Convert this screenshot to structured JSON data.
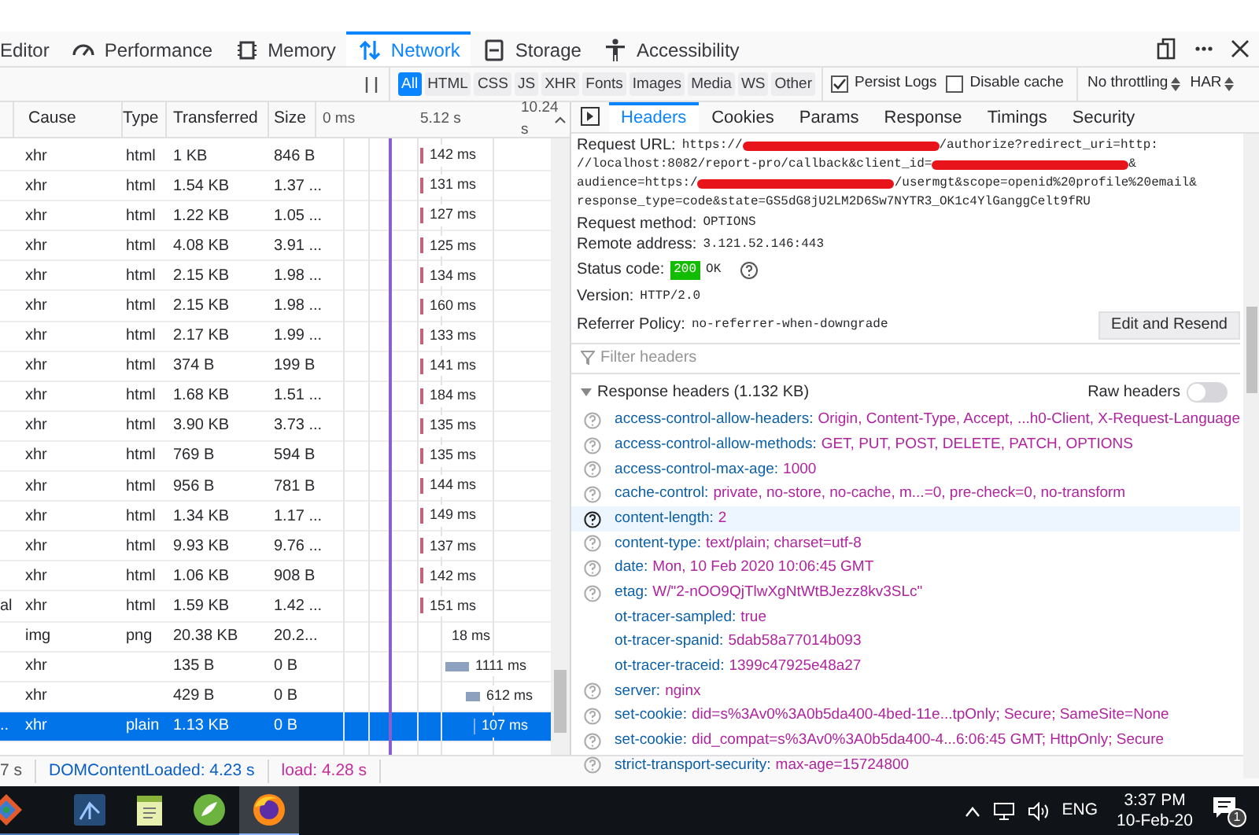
{
  "toolbox_tabs": [
    {
      "label": "Editor",
      "selected": false
    },
    {
      "label": "Performance",
      "selected": false
    },
    {
      "label": "Memory",
      "selected": false
    },
    {
      "label": "Network",
      "selected": true
    },
    {
      "label": "Storage",
      "selected": false
    },
    {
      "label": "Accessibility",
      "selected": false
    }
  ],
  "filters": [
    {
      "label": "All",
      "selected": true
    },
    {
      "label": "HTML",
      "selected": false
    },
    {
      "label": "CSS",
      "selected": false
    },
    {
      "label": "JS",
      "selected": false
    },
    {
      "label": "XHR",
      "selected": false
    },
    {
      "label": "Fonts",
      "selected": false
    },
    {
      "label": "Images",
      "selected": false
    },
    {
      "label": "Media",
      "selected": false
    },
    {
      "label": "WS",
      "selected": false
    },
    {
      "label": "Other",
      "selected": false
    }
  ],
  "options": [
    {
      "label": "Persist Logs",
      "checked": true
    },
    {
      "label": "Disable cache",
      "checked": false
    }
  ],
  "selects": [
    "No throttling",
    "HAR"
  ],
  "columns": [
    "Cause",
    "Type",
    "Transferred",
    "Size"
  ],
  "timeline_ticks": [
    "0 ms",
    "5.12 s",
    "10.24 s"
  ],
  "requests": [
    {
      "cause": "xhr",
      "type": "html",
      "transferred": "1 KB",
      "size": "846 B",
      "time": "142 ms",
      "kind": "tick",
      "selected": false
    },
    {
      "cause": "xhr",
      "type": "html",
      "transferred": "1.54 KB",
      "size": "1.37 ...",
      "time": "131 ms",
      "kind": "tick",
      "selected": false
    },
    {
      "cause": "xhr",
      "type": "html",
      "transferred": "1.22 KB",
      "size": "1.05 ...",
      "time": "127 ms",
      "kind": "tick",
      "selected": false
    },
    {
      "cause": "xhr",
      "type": "html",
      "transferred": "4.08 KB",
      "size": "3.91 ...",
      "time": "125 ms",
      "kind": "tick",
      "selected": false
    },
    {
      "cause": "xhr",
      "type": "html",
      "transferred": "2.15 KB",
      "size": "1.98 ...",
      "time": "134 ms",
      "kind": "tick",
      "selected": false
    },
    {
      "cause": "xhr",
      "type": "html",
      "transferred": "2.15 KB",
      "size": "1.98 ...",
      "time": "160 ms",
      "kind": "tick",
      "selected": false
    },
    {
      "cause": "xhr",
      "type": "html",
      "transferred": "2.17 KB",
      "size": "1.99 ...",
      "time": "133 ms",
      "kind": "tick",
      "selected": false
    },
    {
      "cause": "xhr",
      "type": "html",
      "transferred": "374 B",
      "size": "199 B",
      "time": "141 ms",
      "kind": "tick",
      "selected": false
    },
    {
      "cause": "xhr",
      "type": "html",
      "transferred": "1.68 KB",
      "size": "1.51 ...",
      "time": "184 ms",
      "kind": "tick",
      "selected": false
    },
    {
      "cause": "xhr",
      "type": "html",
      "transferred": "3.90 KB",
      "size": "3.73 ...",
      "time": "135 ms",
      "kind": "tick",
      "selected": false
    },
    {
      "cause": "xhr",
      "type": "html",
      "transferred": "769 B",
      "size": "594 B",
      "time": "135 ms",
      "kind": "tick",
      "selected": false
    },
    {
      "cause": "xhr",
      "type": "html",
      "transferred": "956 B",
      "size": "781 B",
      "time": "144 ms",
      "kind": "tick",
      "selected": false
    },
    {
      "cause": "xhr",
      "type": "html",
      "transferred": "1.34 KB",
      "size": "1.17 ...",
      "time": "149 ms",
      "kind": "tick",
      "selected": false
    },
    {
      "cause": "xhr",
      "type": "html",
      "transferred": "9.93 KB",
      "size": "9.76 ...",
      "time": "137 ms",
      "kind": "tick",
      "selected": false
    },
    {
      "cause": "xhr",
      "type": "html",
      "transferred": "1.06 KB",
      "size": "908 B",
      "time": "142 ms",
      "kind": "tick",
      "selected": false
    },
    {
      "column_1": "al",
      "cause": "xhr",
      "type": "html",
      "transferred": "1.59 KB",
      "size": "1.42 ...",
      "time": "151 ms",
      "kind": "tick",
      "selected": false
    },
    {
      "cause": "img",
      "type": "png",
      "transferred": "20.38 KB",
      "size": "20.2...",
      "time": "18 ms",
      "kind": "late",
      "selected": false
    },
    {
      "cause": "xhr",
      "transferred": "135 B",
      "size": "0 B",
      "time": "1111 ms",
      "kind": "wide",
      "selected": false
    },
    {
      "cause": "xhr",
      "transferred": "429 B",
      "size": "0 B",
      "time": "612 ms",
      "kind": "medium",
      "selected": false
    },
    {
      "column_1": "..",
      "cause": "xhr",
      "type": "plain",
      "transferred": "1.13 KB",
      "size": "0 B",
      "time": "107 ms",
      "kind": "thin",
      "selected": true
    }
  ],
  "status_bar": [
    "7 s",
    "DOMContentLoaded: 4.23 s",
    "load: 4.28 s"
  ],
  "detail_tabs": [
    {
      "label": "Headers",
      "selected": true
    },
    {
      "label": "Cookies",
      "selected": false
    },
    {
      "label": "Params",
      "selected": false
    },
    {
      "label": "Response",
      "selected": false
    },
    {
      "label": "Timings",
      "selected": false
    },
    {
      "label": "Security",
      "selected": false
    }
  ],
  "request_url": {
    "label": "Request URL:",
    "lines": [
      [
        {
          "kind": "text",
          "text": "https://"
        },
        {
          "kind": "redacted"
        },
        {
          "kind": "text",
          "text": "/authorize?redirect_uri=http:"
        }
      ],
      [
        {
          "kind": "text",
          "text": "//localhost:8082/report-pro/callback&client_id="
        },
        {
          "kind": "redacted"
        },
        {
          "kind": "text",
          "text": "&"
        }
      ],
      [
        {
          "kind": "text",
          "text": "audience=https:/"
        },
        {
          "kind": "redacted"
        },
        {
          "kind": "text",
          "text": "/usermgt&scope=openid%20profile%20email&"
        }
      ],
      [
        {
          "kind": "text",
          "text": "response_type=code&state=GS5dG8jU2LM2D6Sw7NYTR3_OK1c4YlGanggCelt9fRU"
        }
      ]
    ]
  },
  "request_method": {
    "label": "Request method:",
    "value": "OPTIONS"
  },
  "remote_address": {
    "label": "Remote address:",
    "value": "3.121.52.146:443"
  },
  "status_code": {
    "label": "Status code:",
    "code": "200",
    "text": "OK"
  },
  "version": {
    "label": "Version:",
    "value": "HTTP/2.0"
  },
  "referrer_policy": {
    "label": "Referrer Policy:",
    "value": "no-referrer-when-downgrade"
  },
  "edit_button": "Edit and Resend",
  "filter_placeholder": "Filter headers",
  "response_headers": {
    "title": "Response headers (1.132 KB)",
    "raw_label": "Raw headers",
    "raw_on": false,
    "items": [
      {
        "name": "access-control-allow-headers:",
        "value": "Origin, Content-Type, Accept, ...h0-Client, X-Request-Language",
        "help": true,
        "hovered": false
      },
      {
        "name": "access-control-allow-methods:",
        "value": "GET, PUT, POST, DELETE, PATCH, OPTIONS",
        "help": true,
        "hovered": false
      },
      {
        "name": "access-control-max-age:",
        "value": "1000",
        "help": true,
        "hovered": false
      },
      {
        "name": "cache-control:",
        "value": "private, no-store, no-cache, m...=0, pre-check=0, no-transform",
        "help": true,
        "hovered": false
      },
      {
        "name": "content-length:",
        "value": "2",
        "help": true,
        "hovered": true
      },
      {
        "name": "content-type:",
        "value": "text/plain; charset=utf-8",
        "help": true,
        "hovered": false
      },
      {
        "name": "date:",
        "value": "Mon, 10 Feb 2020 10:06:45 GMT",
        "help": true,
        "hovered": false
      },
      {
        "name": "etag:",
        "value": "W/\"2-nOO9QjTlwXgNtWtBJezz8kv3SLc\"",
        "help": true,
        "hovered": false
      },
      {
        "name": "ot-tracer-sampled:",
        "value": "true",
        "help": false,
        "hovered": false
      },
      {
        "name": "ot-tracer-spanid:",
        "value": "5dab58a77014b093",
        "help": false,
        "hovered": false
      },
      {
        "name": "ot-tracer-traceid:",
        "value": "1399c47925e48a27",
        "help": false,
        "hovered": false
      },
      {
        "name": "server:",
        "value": "nginx",
        "help": true,
        "hovered": false
      },
      {
        "name": "set-cookie:",
        "value": "did=s%3Av0%3A0b5da400-4bed-11e...tpOnly; Secure; SameSite=None",
        "help": true,
        "hovered": false
      },
      {
        "name": "set-cookie:",
        "value": "did_compat=s%3Av0%3A0b5da400-4...6:06:45 GMT; HttpOnly; Secure",
        "help": true,
        "hovered": false
      },
      {
        "name": "strict-transport-security:",
        "value": "max-age=15724800",
        "help": true,
        "hovered": false
      }
    ]
  },
  "taskbar": {
    "apps": [
      {
        "kind": "diamond",
        "selected": false
      },
      {
        "kind": "tree",
        "selected": false
      },
      {
        "kind": "notepad",
        "selected": false
      },
      {
        "kind": "leaf",
        "selected": false
      },
      {
        "kind": "browser",
        "selected": true
      }
    ],
    "language": "ENG",
    "time": "3:37 PM",
    "date": "10-Feb-20",
    "notifications": "1"
  }
}
